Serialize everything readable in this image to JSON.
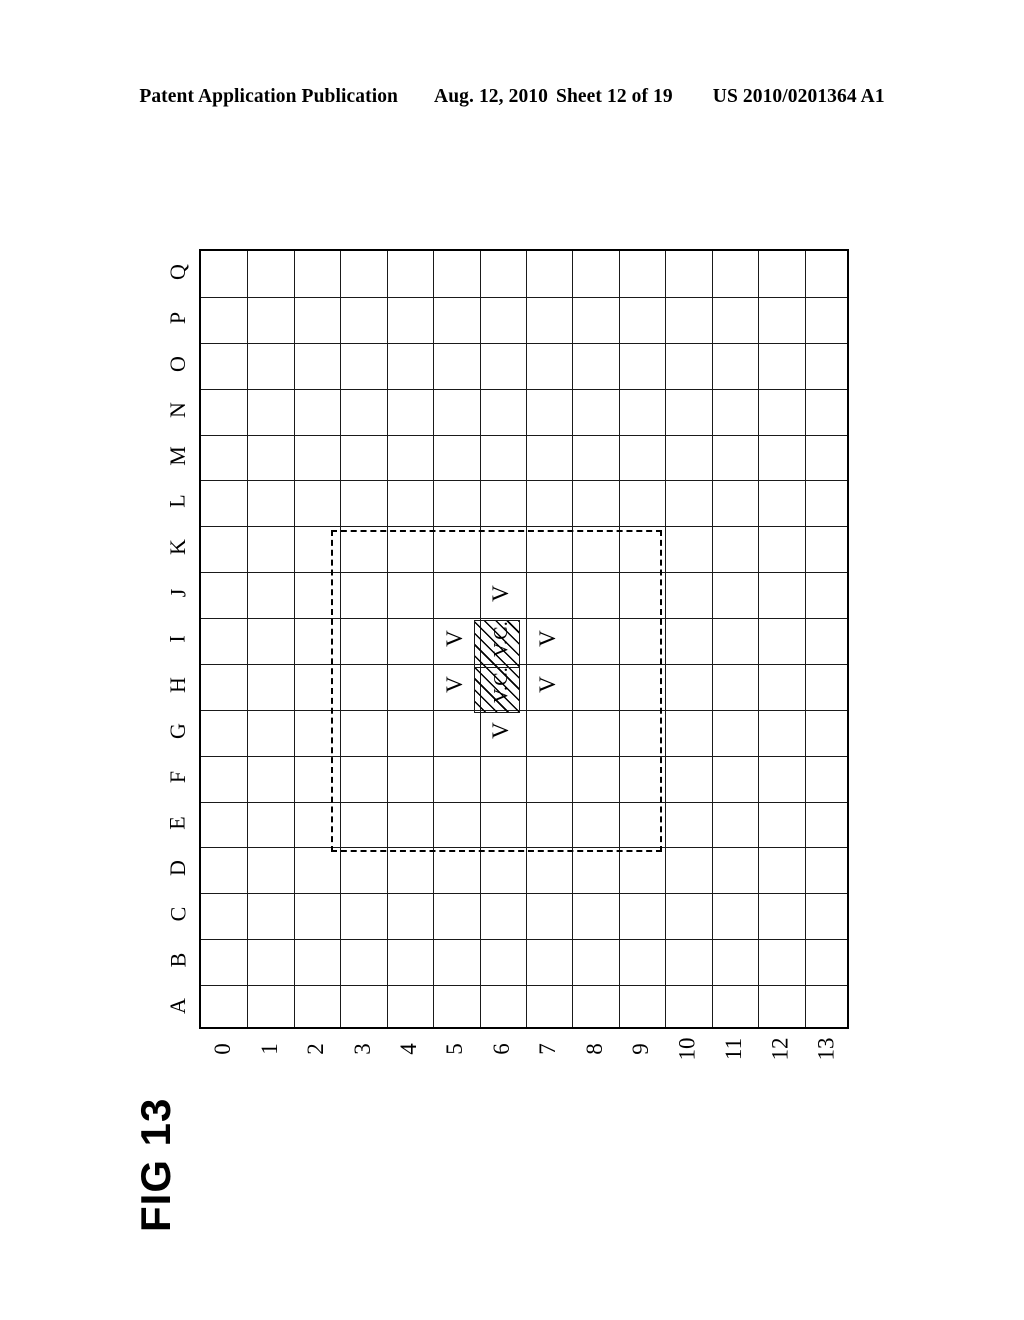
{
  "header": {
    "publication": "Patent Application Publication",
    "date": "Aug. 12, 2010",
    "sheet": "Sheet 12 of 19",
    "number": "US 2010/0201364 A1"
  },
  "figure": {
    "label": "FIG 13",
    "grid": {
      "column_labels": [
        "A",
        "B",
        "C",
        "D",
        "E",
        "F",
        "G",
        "H",
        "I",
        "J",
        "K",
        "L",
        "M",
        "N",
        "O",
        "P",
        "Q"
      ],
      "row_labels": [
        "0",
        "1",
        "2",
        "3",
        "4",
        "5",
        "6",
        "7",
        "8",
        "9",
        "10",
        "11",
        "12",
        "13"
      ],
      "columns": 14,
      "rows": 17,
      "line_color": "#1a1a1a",
      "border_color": "#000000"
    },
    "dashed_region": {
      "name": "region-of-interest",
      "style": "dashed",
      "color": "#000000"
    },
    "hatched_cells": [
      {
        "label": "V.C.",
        "col": "H",
        "row": "6"
      },
      {
        "label": "V.C.",
        "col": "I",
        "row": "6"
      }
    ],
    "marker_cells": [
      {
        "label": "V",
        "col": "J",
        "row": "6"
      },
      {
        "label": "V",
        "col": "I",
        "row": "5"
      },
      {
        "label": "V",
        "col": "I",
        "row": "7"
      },
      {
        "label": "V",
        "col": "H",
        "row": "5"
      },
      {
        "label": "V",
        "col": "H",
        "row": "7"
      },
      {
        "label": "V",
        "col": "G",
        "row": "6"
      }
    ]
  }
}
